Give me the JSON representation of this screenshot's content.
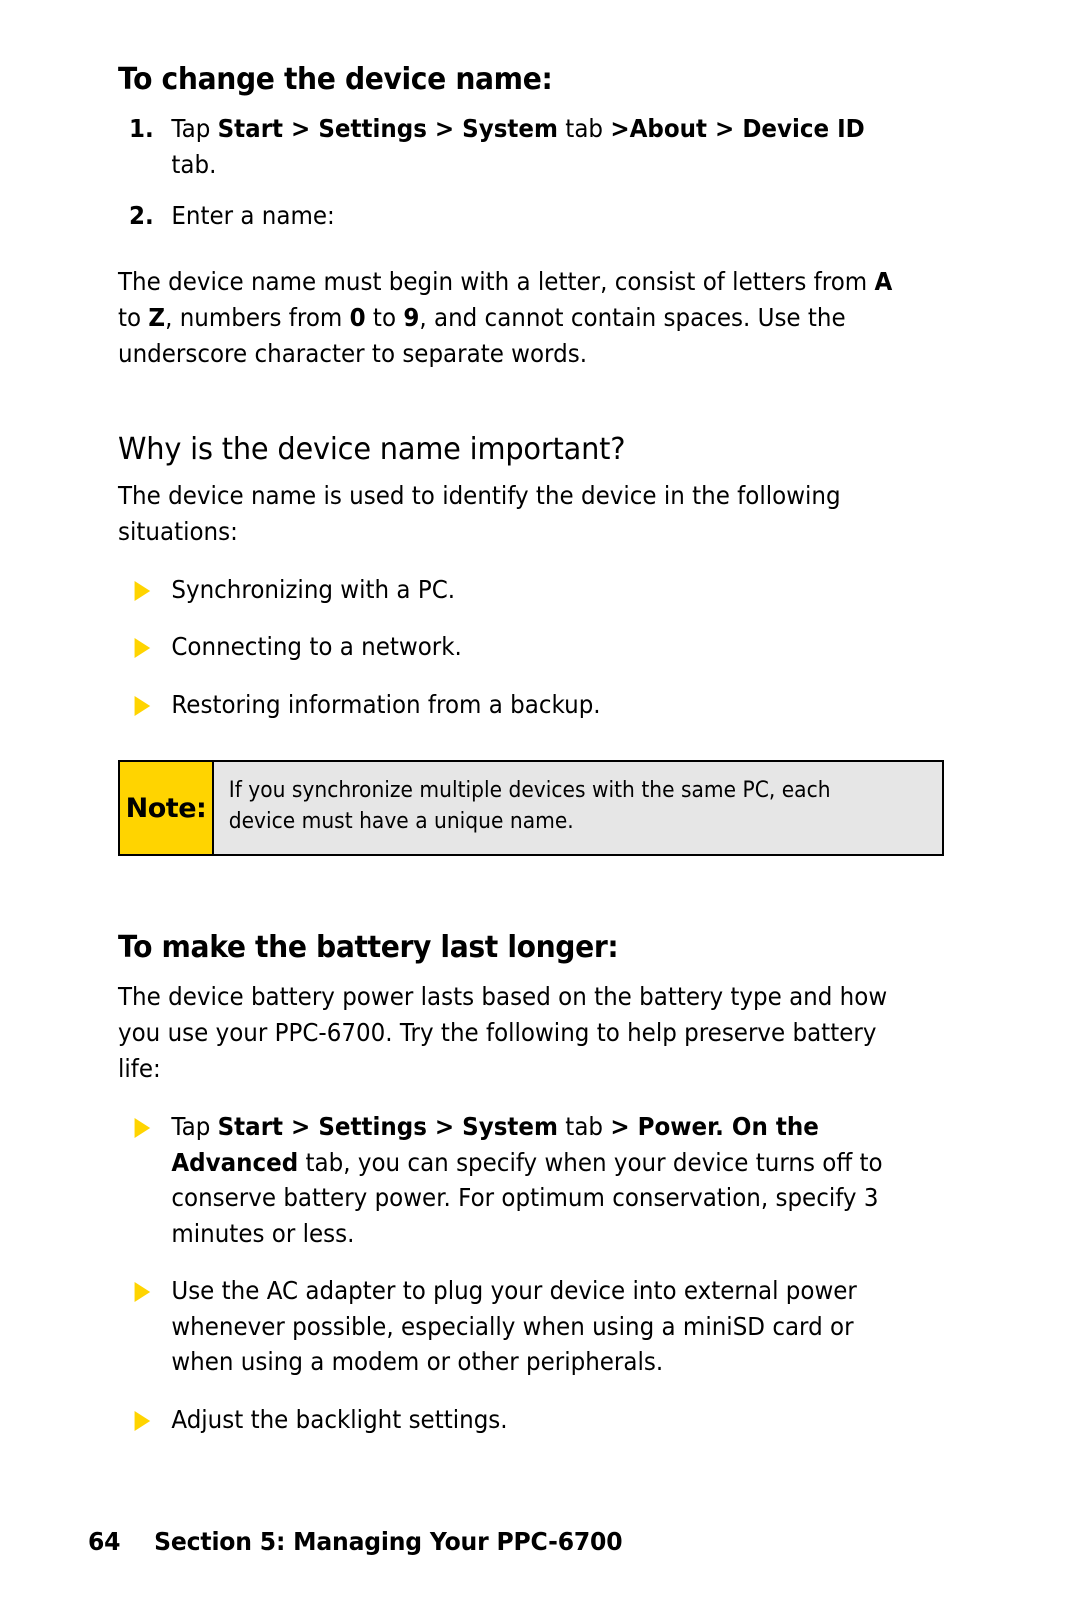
{
  "page": {
    "number": "64",
    "footer_text": "Section 5: Managing Your PPC-6700"
  },
  "colors": {
    "bullet_yellow": "#FFD400",
    "note_label_bg": "#FFD400",
    "note_body_bg": "#E6E6E6",
    "border": "#000000",
    "text": "#000000"
  },
  "sections": {
    "change_device_name": {
      "heading": "To change the device name:",
      "steps": [
        {
          "number": "1.",
          "html": "Tap <b>Start &gt; Settings &gt; System</b> tab <b>&gt;About &gt; Device ID</b> tab."
        },
        {
          "number": "2.",
          "html": "Enter a name:"
        }
      ],
      "paragraph_html": "The device name must begin with a letter, consist of letters from <b>A</b> to <b>Z</b>, numbers from <b>0</b> to <b>9</b>, and cannot contain spaces. Use the underscore character to separate words."
    },
    "why_important": {
      "heading": "Why is the device name important?",
      "paragraph": "The device name is used to identify the device in the following situations:",
      "bullets": [
        "Synchronizing with a PC.",
        "Connecting to a network.",
        "Restoring information from a backup."
      ]
    },
    "note": {
      "label": "Note:",
      "text": "If you synchronize multiple devices with the same PC, each device must have a unique name."
    },
    "battery": {
      "heading": "To make the battery last longer:",
      "paragraph": "The device battery power lasts based on the battery type and how you use your PPC-6700. Try the following to help preserve battery life:",
      "bullets": [
        {
          "html": "Tap <b>Start &gt; Settings &gt; System</b> tab <b>&gt; Power. On the Advanced</b> tab, you can specify when your device turns off to conserve battery power. For optimum conservation, specify 3 minutes or less."
        },
        {
          "html": "Use the AC adapter to plug your device into external power whenever possible, especially when using a miniSD card or when using a modem or other peripherals."
        },
        {
          "html": "Adjust the backlight settings."
        }
      ]
    }
  }
}
